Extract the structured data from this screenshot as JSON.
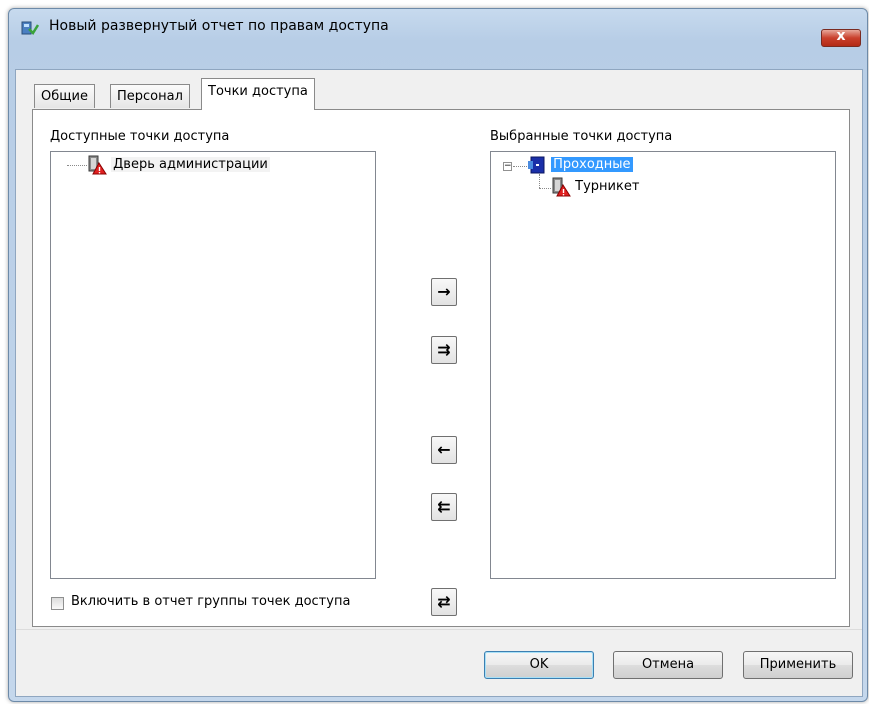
{
  "window": {
    "title": "Новый развернутый отчет по правам доступа",
    "close_symbol": "x"
  },
  "tabs": [
    {
      "label": "Общие"
    },
    {
      "label": "Персонал"
    },
    {
      "label": "Точки доступа"
    }
  ],
  "active_tab": "Точки доступа",
  "left_panel": {
    "label": "Доступные точки доступа",
    "items": [
      {
        "label": "Дверь администрации",
        "icon": "door-alert-icon"
      }
    ]
  },
  "right_panel": {
    "label": "Выбранные точки доступа",
    "tree": {
      "group": {
        "label": "Проходные",
        "icon": "group-door-icon",
        "expanded": true,
        "expander": "−"
      },
      "children": [
        {
          "label": "Турникет",
          "icon": "door-alert-icon"
        }
      ]
    }
  },
  "move_buttons": [
    {
      "name": "move-selected-right",
      "symbol": "→",
      "icon": "arrow-right-icon"
    },
    {
      "name": "move-all-right",
      "symbol": "⇉",
      "icon": "double-arrow-right-icon"
    },
    {
      "name": "move-selected-left",
      "symbol": "←",
      "icon": "arrow-left-icon"
    },
    {
      "name": "move-all-left",
      "symbol": "⇇",
      "icon": "double-arrow-left-icon"
    },
    {
      "name": "swap",
      "symbol": "⇄",
      "icon": "swap-arrows-icon"
    }
  ],
  "include_groups_checkbox": {
    "label": "Включить в отчет группы точек доступа",
    "checked": false
  },
  "buttons": {
    "ok": "OK",
    "cancel": "Отмена",
    "apply": "Применить"
  },
  "colors": {
    "selection": "#3399ff",
    "window_frame": "#b7cde6",
    "close_button": "#c9402c"
  }
}
